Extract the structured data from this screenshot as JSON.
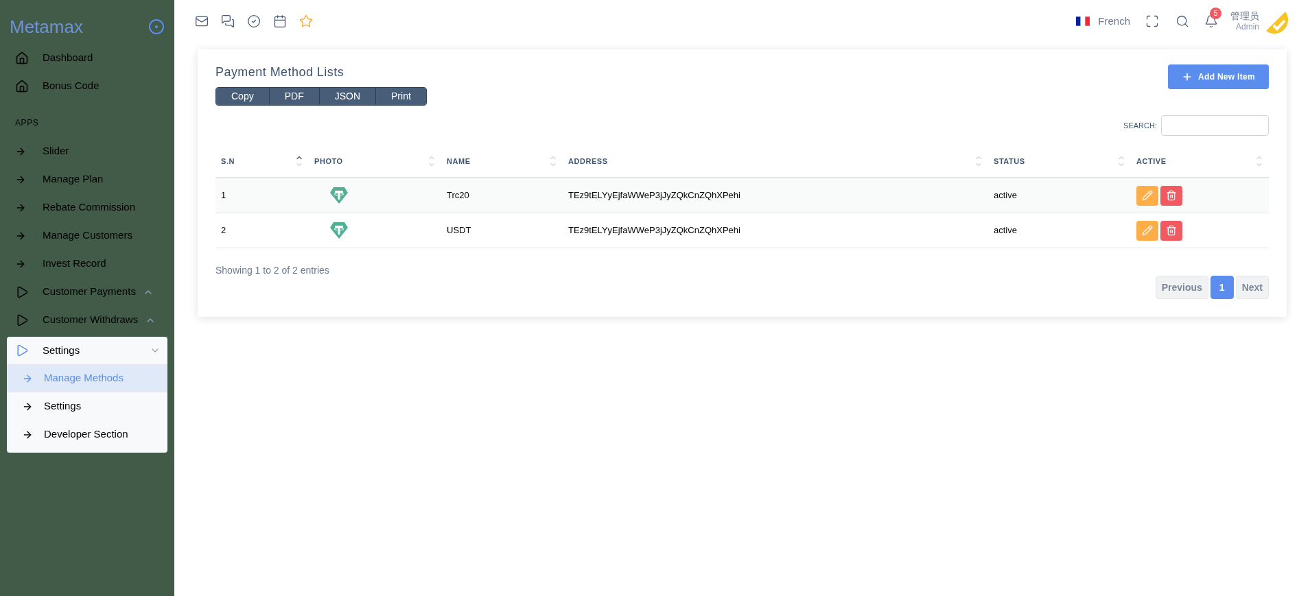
{
  "sidebar": {
    "brand": "Metamax",
    "items": [
      {
        "kind": "home",
        "label": "Dashboard"
      },
      {
        "kind": "home",
        "label": "Bonus Code"
      },
      {
        "kind": "heading",
        "label": "APPS"
      },
      {
        "kind": "arrow",
        "label": "Slider"
      },
      {
        "kind": "arrow",
        "label": "Manage Plan"
      },
      {
        "kind": "arrow",
        "label": "Rebate Commission"
      },
      {
        "kind": "arrow",
        "label": "Manage Customers"
      },
      {
        "kind": "arrow",
        "label": "Invest Record"
      },
      {
        "kind": "group",
        "label": "Customer Payments",
        "expanded": false
      },
      {
        "kind": "group",
        "label": "Customer Withdraws",
        "expanded": false
      },
      {
        "kind": "group",
        "label": "Settings",
        "expanded": true,
        "children": [
          {
            "label": "Manage Methods",
            "selected": true
          },
          {
            "label": "Settings",
            "selected": false
          },
          {
            "label": "Developer Section",
            "selected": false
          }
        ]
      }
    ]
  },
  "topbar": {
    "language": "French",
    "notifications": "5",
    "user_name": "管理员",
    "user_role": "Admin"
  },
  "card": {
    "title": "Payment Method Lists",
    "export_buttons": [
      "Copy",
      "PDF",
      "JSON",
      "Print"
    ],
    "add_button": "Add New Item",
    "search_label": "SEARCH:",
    "table": {
      "columns": [
        {
          "label": "S.N",
          "sorted": true
        },
        {
          "label": "PHOTO",
          "sorted": false
        },
        {
          "label": "NAME",
          "sorted": false
        },
        {
          "label": "ADDRESS",
          "sorted": false
        },
        {
          "label": "STATUS",
          "sorted": false
        },
        {
          "label": "ACTIVE",
          "sorted": false
        }
      ],
      "rows": [
        {
          "sn": "1",
          "name": "Trc20",
          "address": "TEz9tELYyEjfaWWeP3jJyZQkCnZQhXPehi",
          "status": "active"
        },
        {
          "sn": "2",
          "name": "USDT",
          "address": "TEz9tELYyEjfaWWeP3jJyZQkCnZQhXPehi",
          "status": "active"
        }
      ]
    },
    "info": "Showing 1 to 2 of 2 entries",
    "pagination": [
      {
        "label": "Previous",
        "kind": "nav",
        "selected": false
      },
      {
        "label": "1",
        "kind": "page",
        "selected": true
      },
      {
        "label": "Next",
        "kind": "nav",
        "selected": false
      }
    ]
  }
}
